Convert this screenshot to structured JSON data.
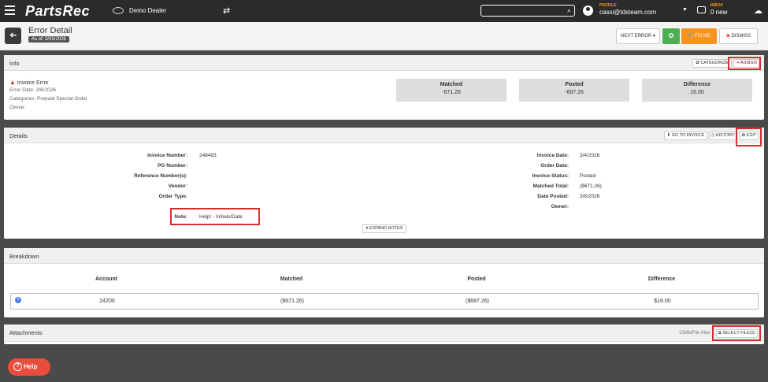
{
  "topbar": {
    "logo": "PartsRec",
    "dealer_name": "Demo Dealer",
    "search_icon": "⌕",
    "profile_label": "PROFILE",
    "profile_email": "cassi@tdsteam.com",
    "inbox_label": "INBOX",
    "inbox_count": "0 new"
  },
  "header": {
    "title": "Error Detail",
    "as_of": "As of: 3/25/2026",
    "back_icon": "➔",
    "next_error": "NEXT ERROR ▾",
    "fix_me": "🔧 FIX ME",
    "dismiss": "DISMISS"
  },
  "info": {
    "title": "Info",
    "categorize": "✿ CATEGORIZE",
    "assign": "↪ ASSIGN",
    "error_type": "Invoice Error",
    "error_date": "Error Date: 3/6/2026",
    "categories": "Categories: Prepaid Special Order",
    "owner": "Owner:",
    "stats": [
      {
        "label": "Matched",
        "value": "-671.26"
      },
      {
        "label": "Posted",
        "value": "-687.26"
      },
      {
        "label": "Difference",
        "value": "16.00"
      }
    ]
  },
  "details": {
    "title": "Details",
    "go_to_invoice": "⬆ GO TO INVOICE",
    "history": "◷ HISTORY",
    "edit": "✿ EDIT",
    "left": [
      {
        "label": "Invoice Number:",
        "value": "248493"
      },
      {
        "label": "PO Number:",
        "value": ""
      },
      {
        "label": "Reference Number(s):",
        "value": ""
      },
      {
        "label": "Vendor:",
        "value": ""
      },
      {
        "label": "Order Type:",
        "value": ""
      }
    ],
    "note_label": "Note:",
    "note_value": "Help! - Initials/Date",
    "right": [
      {
        "label": "Invoice Date:",
        "value": "3/4/2026"
      },
      {
        "label": "Order Date:",
        "value": ""
      },
      {
        "label": "Invoice Status:",
        "value": "Posted"
      },
      {
        "label": "Matched Total:",
        "value": "($671.26)"
      },
      {
        "label": "Date Posted:",
        "value": "3/6/2026"
      },
      {
        "label": "Owner:",
        "value": ""
      }
    ],
    "expand_notes": "▾ EXPAND NOTES"
  },
  "breakdown": {
    "title": "Breakdown",
    "columns": [
      "Account",
      "Matched",
      "Posted",
      "Difference"
    ],
    "rows": [
      {
        "account": "24200",
        "matched": "($671.26)",
        "posted": "($687.26)",
        "difference": "$16.00"
      }
    ]
  },
  "attachments": {
    "title": "Attachments",
    "file_max": "10Mb/File Max",
    "select_files": "⧉ SELECT FILE(S)"
  },
  "help": {
    "label": "Help",
    "icon": "?"
  },
  "colors": {
    "accent_orange": "#f7931e",
    "success_green": "#4caf50",
    "danger_red": "#d32f2f",
    "help_red": "#e94e3c",
    "topbar": "#2b2b2b"
  }
}
